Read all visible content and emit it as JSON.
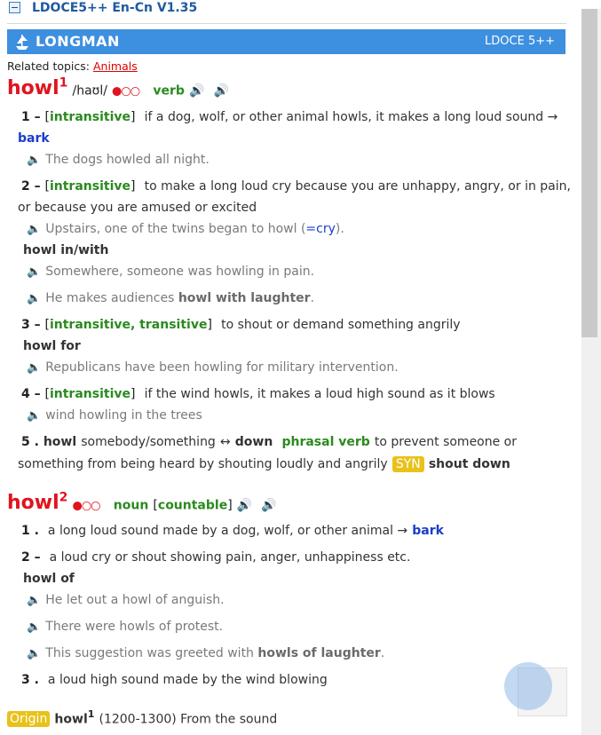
{
  "app": {
    "title": "LDOCE5++ En-Cn V1.35"
  },
  "banner": {
    "brand": "LONGMAN",
    "version": "LDOCE 5++"
  },
  "related": {
    "label": "Related topics:",
    "topic": "Animals"
  },
  "entry1": {
    "headword": "howl",
    "homnum": "1",
    "pron": "/haʊl/",
    "freq": "●○○",
    "pos": "verb",
    "senses": [
      {
        "num": "1",
        "gram": "intransitive",
        "def": "if a dog, wolf, or other animal howls, it makes a long loud sound →",
        "xref": "bark",
        "examples": [
          "The dogs howled all night."
        ]
      },
      {
        "num": "2",
        "gram": "intransitive",
        "def_line1": "to make a long loud cry because you are unhappy, angry, or in pain,",
        "def_line2": "or because you are amused or excited",
        "example1": "Upstairs, one of the twins began to howl (",
        "example1_eq": "=cry",
        "example1_end": ").",
        "phrase": "howl in/with",
        "examples_phrase": [
          "Somewhere, someone was howling in pain."
        ],
        "example_last_pre": "He makes audiences ",
        "example_last_bold": "howl with laughter",
        "example_last_end": "."
      },
      {
        "num": "3",
        "gram": "intransitive, transitive",
        "def": "to shout or demand something angrily",
        "phrase": "howl for",
        "examples": [
          "Republicans have been howling for military intervention."
        ]
      },
      {
        "num": "4",
        "gram": "intransitive",
        "def": "if the wind howls, it makes a loud high sound as it blows",
        "examples": [
          "wind howling in the trees"
        ]
      },
      {
        "num": "5",
        "pv": "howl",
        "pv_obj": "somebody/something",
        "arrow": "↔",
        "pv_particle": "down",
        "pv_label": "phrasal verb",
        "def_line1": "to prevent someone or",
        "def_line2": "something from being heard by shouting loudly and angrily",
        "syn_label": "SYN",
        "syn_word": "shout down"
      }
    ]
  },
  "entry2": {
    "headword": "howl",
    "homnum": "2",
    "freq": "●○○",
    "pos": "noun",
    "gram": "countable",
    "senses": [
      {
        "num": "1",
        "def": "a long loud sound made by a dog, wolf, or other animal →",
        "xref": "bark"
      },
      {
        "num": "2",
        "def": "a loud cry or shout showing pain, anger, unhappiness etc.",
        "phrase": "howl of",
        "examples": [
          "He let out a howl of anguish.",
          "There were howls of protest."
        ],
        "ex3_pre": "This suggestion was greeted with ",
        "ex3_bold": "howls of laughter",
        "ex3_end": "."
      },
      {
        "num": "3",
        "def": "a loud high sound made by the wind blowing"
      }
    ]
  },
  "origin": {
    "label": "Origin",
    "word": "howl",
    "homnum": "1",
    "text": "(1200-1300) From the sound"
  },
  "colors": {
    "accent": "#3d8fe0",
    "headword": "#e0141e",
    "grammar": "#2a8a1e",
    "xref": "#1a3ccc",
    "tag": "#e8c21a"
  },
  "icons": {
    "speaker": "speaker-icon",
    "collapse": "collapse-icon",
    "logo": "ship-logo-icon"
  }
}
